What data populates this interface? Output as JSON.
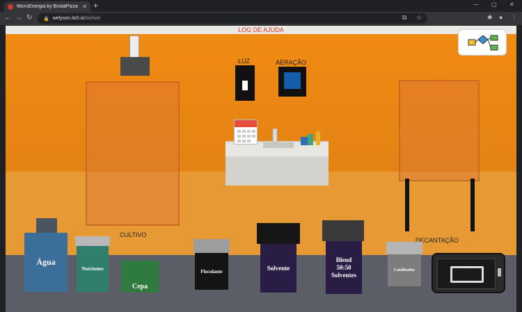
{
  "browser": {
    "tab_title": "MicroEnergia by BrutalPizza",
    "tab_close": "✕",
    "new_tab": "+",
    "url_host": "welyson.itch.io",
    "url_path": "/biofuel",
    "back": "←",
    "forward": "→",
    "reload": "↻",
    "home": "⌂"
  },
  "game": {
    "help_log": "LOG DE AJUDA",
    "light_label": "LUZ",
    "aeration_label": "AERAÇÃO",
    "cultivo_label": "CULTIVO",
    "decant_label": "DECANTAÇÃO",
    "items": {
      "agua": "Água",
      "nutrientes": "Nutrientes",
      "cepa": "Cepa",
      "floculante": "Floculante",
      "solvente": "Solvente",
      "blend": "Blend 50:50 Solventes",
      "catalisador": "Catalisador"
    }
  },
  "colors": {
    "wall": "#f08a12",
    "floor": "#e79a33",
    "help_text": "#e53420",
    "aeration_button": "#145ea8"
  }
}
